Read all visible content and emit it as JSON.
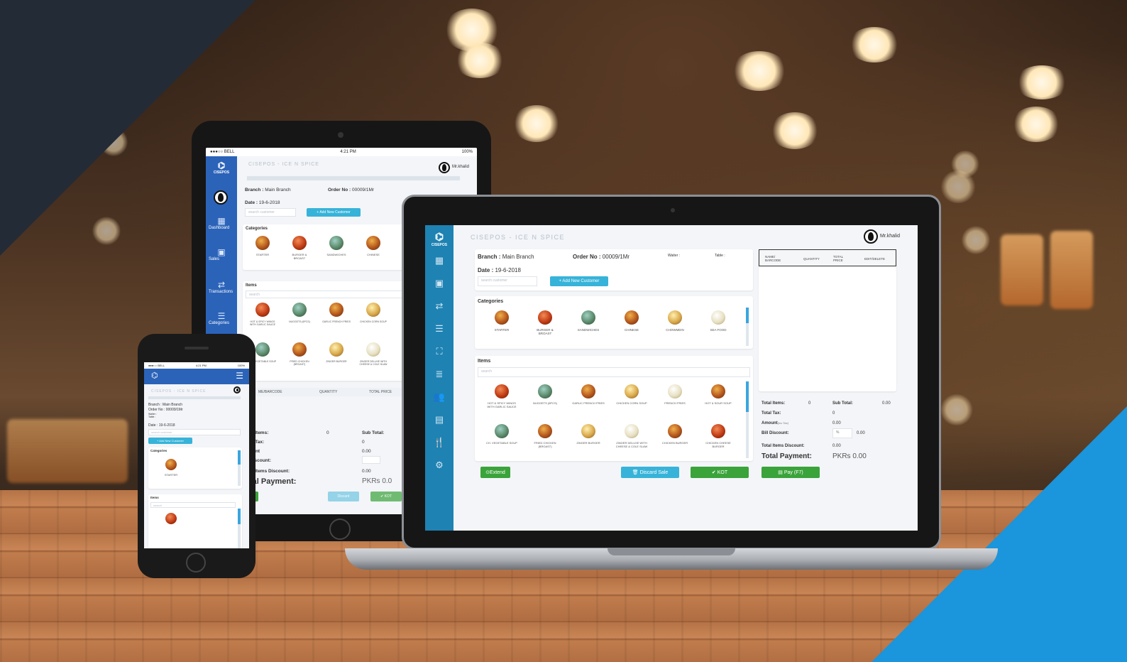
{
  "app": {
    "title": "CISEPOS - ICE N SPICE",
    "logo_label": "CISEPOS",
    "user": "Mr.khalid"
  },
  "status_bar": {
    "carrier": "●●●○○ BELL",
    "time": "4:21 PM",
    "battery": "100%"
  },
  "order": {
    "branch_label": "Branch :",
    "branch_value": "Main Branch",
    "order_no_label": "Order No :",
    "order_no_value": "00009/1Mr",
    "date_label": "Date :",
    "date_value": "19-6-2018",
    "waiter_label": "Waiter :",
    "table_label": "Table :",
    "search_customer_placeholder": "search customer",
    "add_customer_label": "+ Add New Customer"
  },
  "sidebar": {
    "items": [
      {
        "label": "Dashboard",
        "icon": "dashboard-icon"
      },
      {
        "label": "Sales",
        "icon": "sales-icon"
      },
      {
        "label": "Transactions",
        "icon": "transactions-icon"
      },
      {
        "label": "Categories",
        "icon": "categories-icon"
      }
    ],
    "laptop_icons": [
      "dashboard-icon",
      "sales-icon",
      "transactions-icon",
      "categories-icon",
      "hierarchy-icon",
      "list-icon",
      "users-icon",
      "document-icon",
      "utensils-icon",
      "gear-icon"
    ]
  },
  "categories": {
    "heading": "Categories",
    "items": [
      "STARTER",
      "BURGER & BROAST",
      "SANDWICHES",
      "CHINESE",
      "CHOWMEIN",
      "SEA FOOD"
    ],
    "tablet_items": [
      "STARTER",
      "BURGER & BROAST",
      "SANDWICHES",
      "CHINESE"
    ]
  },
  "items": {
    "heading": "Items",
    "search_placeholder": "search",
    "row1": [
      "HOT & SPICY WINGS WITH GARLIC SAUCE",
      "NUGGETS (6PCS)",
      "GARLIC FRENCH FRIES",
      "CHICKEN CORN SOUP",
      "FRENCH FRIES",
      "HOT & SOUR SOUP"
    ],
    "row2": [
      "CH. VEGETABLE SOUP",
      "FRIED CHICKEN (BROAST)",
      "ZINGER BURGER",
      "ZINGER DELUXE WITH CHEESE & COLE SLAW",
      "CHICKEN BURGER",
      "CHICKEN CHEESE BURGER"
    ]
  },
  "cart": {
    "columns": [
      "NAME/ BARCODE",
      "QUANTITY",
      "TOTAL PRICE",
      "EDIT/DELETE"
    ]
  },
  "totals": {
    "total_items_label": "Total Items:",
    "total_items_value": "0",
    "sub_total_label": "Sub Total:",
    "sub_total_value": "0.00",
    "total_tax_label": "Total Tax:",
    "total_tax_value": "0",
    "amount_label": "Amount",
    "amount_suffix": "(Inc Tax)",
    "amount_value": "0.00",
    "bill_discount_label": "Bill Discount:",
    "bill_discount_input": "%",
    "bill_discount_value": "0.00",
    "items_discount_label": "Total Items Discount:",
    "items_discount_value": "0.00",
    "total_payment_label": "Total Payment:",
    "total_payment_value": "PKRs 0.00"
  },
  "actions": {
    "extend": "⊙Extend",
    "discard": "🗑 Discard Sale",
    "kot": "✔ KOT",
    "pay": "▤ Pay (F7)"
  },
  "tablet_partial": {
    "total_items": "al Items:",
    "tax": "al Tax:",
    "amount": "ount",
    "discount": "Discount:",
    "items_discount": "al Items Discount:",
    "payment": "tal Payment:",
    "payment_value": "PKRs 0.0",
    "name_barcode": "ME/BARCODE",
    "quantity": "QUANTITY",
    "total_price": "TOTAL PRICE",
    "sub_total": "Sub Total:",
    "zero": "0",
    "zero2": "0.00",
    "discard": "Discard",
    "kot": "✔ KOT"
  },
  "colors": {
    "sidebar_tablet": "#2b63b9",
    "sidebar_laptop": "#1e82b3",
    "green": "#3aa33a",
    "cyan": "#37b3d9",
    "accent_blue": "#1b95db",
    "corner_dark": "#232b36"
  }
}
